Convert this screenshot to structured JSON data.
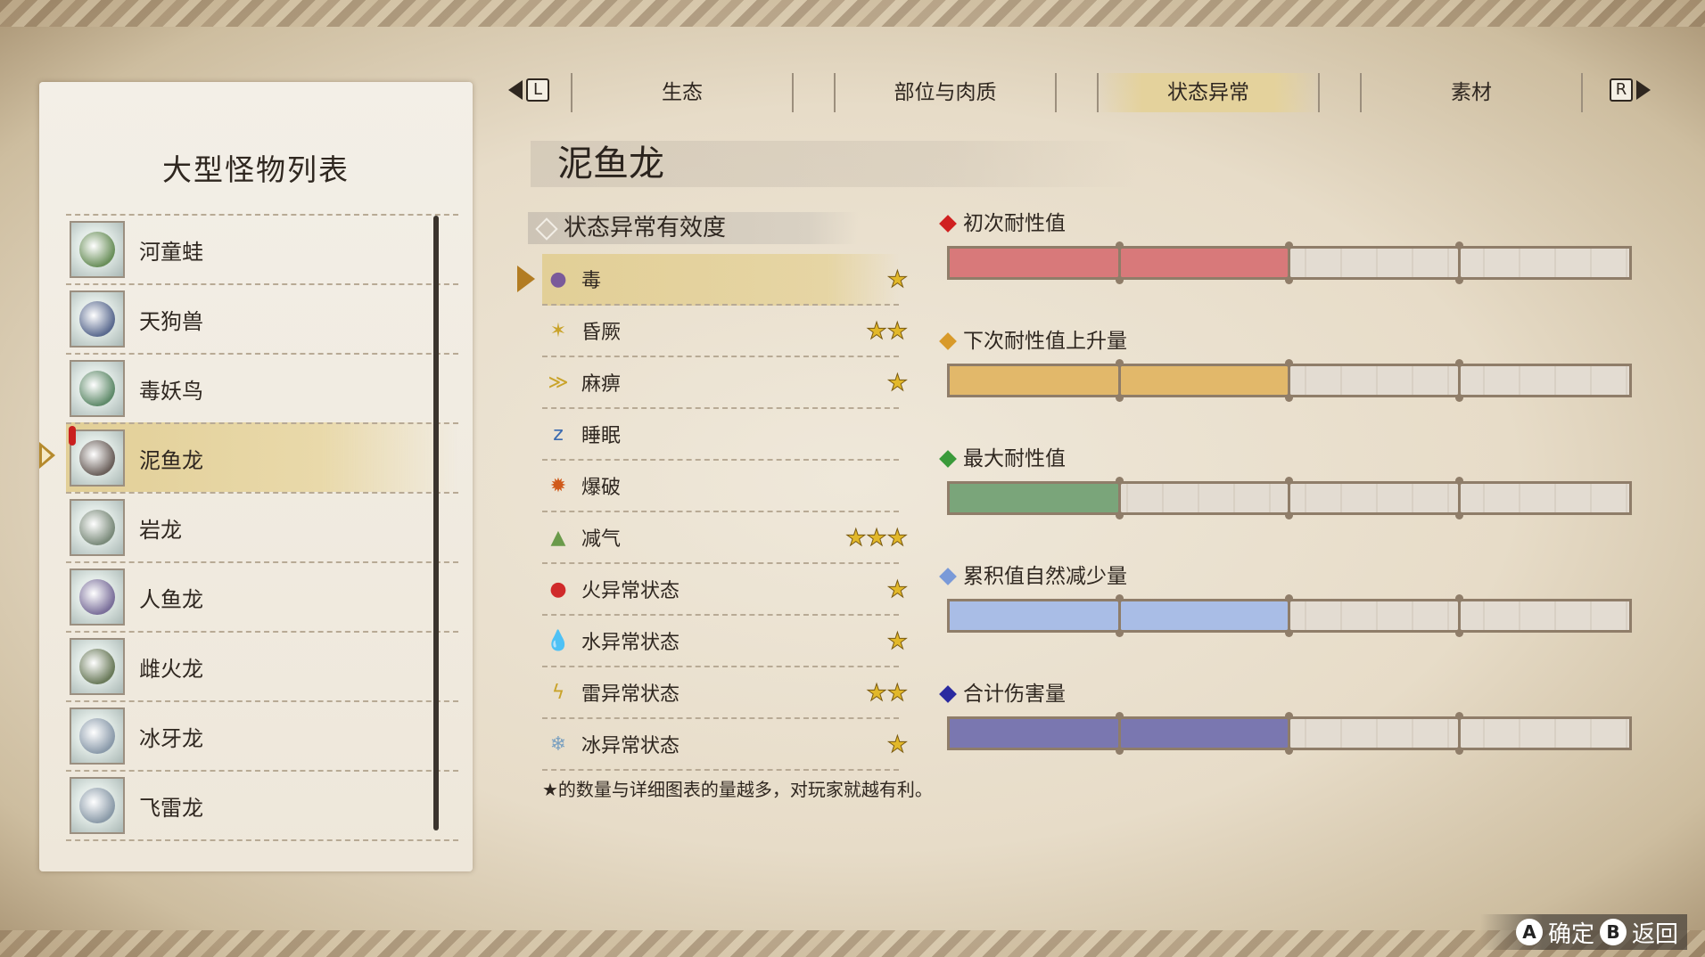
{
  "tabs": {
    "left_key": "L",
    "right_key": "R",
    "items": [
      "生态",
      "部位与肉质",
      "状态异常",
      "素材"
    ],
    "active_index": 2
  },
  "left_panel": {
    "title": "大型怪物列表",
    "monsters": [
      {
        "name": "河童蛙",
        "color": "#6a8f5a"
      },
      {
        "name": "天狗兽",
        "color": "#5a6a8f"
      },
      {
        "name": "毒妖鸟",
        "color": "#5f8a6a"
      },
      {
        "name": "泥鱼龙",
        "color": "#6a5f5a",
        "selected": true
      },
      {
        "name": "岩龙",
        "color": "#7a8a7a"
      },
      {
        "name": "人鱼龙",
        "color": "#7a6f9a"
      },
      {
        "name": "雌火龙",
        "color": "#6a7a5a"
      },
      {
        "name": "冰牙龙",
        "color": "#8a9aaa"
      },
      {
        "name": "飞雷龙",
        "color": "#8a9aa8"
      }
    ]
  },
  "monster_title": "泥鱼龙",
  "status_section": {
    "header": "状态异常有效度",
    "items": [
      {
        "name": "毒",
        "stars": 1,
        "icon": "poison-icon",
        "glyph": "●",
        "color": "#7a5a9a",
        "selected": true
      },
      {
        "name": "昏厥",
        "stars": 2,
        "icon": "stun-icon",
        "glyph": "✶",
        "color": "#c9a32a"
      },
      {
        "name": "麻痹",
        "stars": 1,
        "icon": "paralysis-icon",
        "glyph": "≫",
        "color": "#c9a32a"
      },
      {
        "name": "睡眠",
        "stars": 0,
        "icon": "sleep-icon",
        "glyph": "z",
        "color": "#3a6ab0"
      },
      {
        "name": "爆破",
        "stars": 0,
        "icon": "blast-icon",
        "glyph": "✹",
        "color": "#d05a1a"
      },
      {
        "name": "减气",
        "stars": 3,
        "icon": "exhaust-icon",
        "glyph": "▲",
        "color": "#6a9a4a"
      },
      {
        "name": "火异常状态",
        "stars": 1,
        "icon": "fire-icon",
        "glyph": "●",
        "color": "#d02a2a"
      },
      {
        "name": "水异常状态",
        "stars": 1,
        "icon": "water-icon",
        "glyph": "💧",
        "color": "#3a8ad0"
      },
      {
        "name": "雷异常状态",
        "stars": 2,
        "icon": "thunder-icon",
        "glyph": "ϟ",
        "color": "#c9a32a"
      },
      {
        "name": "冰异常状态",
        "stars": 1,
        "icon": "ice-icon",
        "glyph": "❄",
        "color": "#7aa0c0"
      }
    ],
    "note": "★的数量与详细图表的量越多，对玩家就越有利。"
  },
  "bars": [
    {
      "label": "初次耐性值",
      "level": 2,
      "max": 4,
      "fill": "#d8797a",
      "marker": "#d02020"
    },
    {
      "label": "下次耐性值上升量",
      "level": 2,
      "max": 4,
      "fill": "#e2b86a",
      "marker": "#d89a2a"
    },
    {
      "label": "最大耐性值",
      "level": 1,
      "max": 4,
      "fill": "#7aa57a",
      "marker": "#3a9a3a"
    },
    {
      "label": "累积值自然减少量",
      "level": 2,
      "max": 4,
      "fill": "#a9bde6",
      "marker": "#7a9ad8"
    },
    {
      "label": "合计伤害量",
      "level": 2,
      "max": 4,
      "fill": "#7a77b0",
      "marker": "#2a2aa0"
    }
  ],
  "buttons": {
    "confirm_key": "A",
    "confirm": "确定",
    "back_key": "B",
    "back": "返回"
  }
}
